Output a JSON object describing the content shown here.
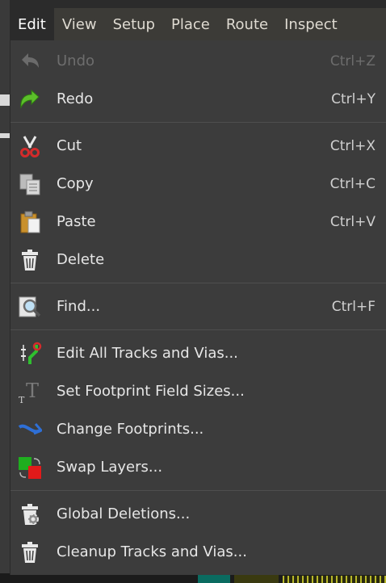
{
  "menubar": {
    "items": [
      {
        "label": "Edit",
        "active": true
      },
      {
        "label": "View"
      },
      {
        "label": "Setup"
      },
      {
        "label": "Place"
      },
      {
        "label": "Route"
      },
      {
        "label": "Inspect"
      }
    ]
  },
  "menu": {
    "undo": {
      "label": "Undo",
      "shortcut": "Ctrl+Z",
      "enabled": false,
      "icon": "undo-arrow-icon"
    },
    "redo": {
      "label": "Redo",
      "shortcut": "Ctrl+Y",
      "icon": "redo-arrow-icon"
    },
    "cut": {
      "label": "Cut",
      "shortcut": "Ctrl+X",
      "icon": "scissors-icon"
    },
    "copy": {
      "label": "Copy",
      "shortcut": "Ctrl+C",
      "icon": "copy-icon"
    },
    "paste": {
      "label": "Paste",
      "shortcut": "Ctrl+V",
      "icon": "clipboard-icon"
    },
    "delete": {
      "label": "Delete",
      "shortcut": "",
      "icon": "trash-icon"
    },
    "find": {
      "label": "Find...",
      "shortcut": "Ctrl+F",
      "icon": "magnifier-icon"
    },
    "edit_tracks": {
      "label": "Edit All Tracks and Vias...",
      "shortcut": "",
      "icon": "tracks-vias-icon"
    },
    "footprint_sizes": {
      "label": "Set Footprint Field Sizes...",
      "shortcut": "",
      "icon": "text-size-icon"
    },
    "change_footprints": {
      "label": "Change Footprints...",
      "shortcut": "",
      "icon": "exchange-icon"
    },
    "swap_layers": {
      "label": "Swap Layers...",
      "shortcut": "",
      "icon": "swap-layers-icon"
    },
    "global_deletions": {
      "label": "Global Deletions...",
      "shortcut": "",
      "icon": "trash-gear-icon"
    },
    "cleanup": {
      "label": "Cleanup Tracks and Vias...",
      "shortcut": "",
      "icon": "trash-cleanup-icon"
    }
  },
  "colors": {
    "menu_bg": "#3c3c3c",
    "text": "#e6e6e6",
    "disabled_text": "#6d6d6d",
    "redo_green": "#5cbf2a",
    "cut_red": "#d42b2b"
  }
}
